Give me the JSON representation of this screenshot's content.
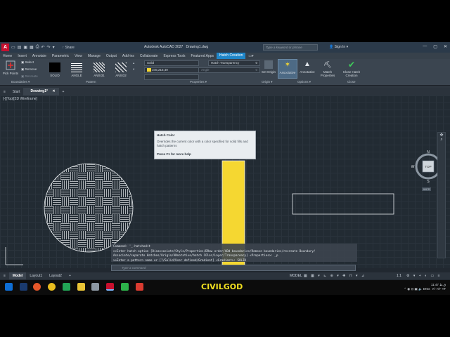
{
  "titlebar": {
    "app_title": "Autodesk AutoCAD 2027",
    "file_title": "Drawing1.dwg",
    "share_label": "Share",
    "search_placeholder": "Type a keyword or phrase",
    "signin_label": "Sign In"
  },
  "ribbon_tabs": [
    "Home",
    "Insert",
    "Annotate",
    "Parametric",
    "View",
    "Manage",
    "Output",
    "Add-ins",
    "Collaborate",
    "Express Tools",
    "Featured Apps",
    "Hatch Creation"
  ],
  "ribbon": {
    "pick_points": "Pick Points",
    "select": "Select",
    "remove": "Remove",
    "recreate": "Recreate",
    "boundaries_label": "Boundaries",
    "patterns": [
      "SOLID",
      "ANGLE",
      "ANSI31",
      "ANSI32"
    ],
    "pattern_label": "Pattern",
    "prop_type": "Solid",
    "prop_color": "245,215,49",
    "prop_transparency_label": "Hatch Transparency",
    "prop_transparency_value": "0",
    "prop_angle_label": "Angle",
    "prop_angle_value": "0",
    "properties_label": "Properties",
    "set_origin": "Set Origin",
    "origin_label": "Origin",
    "associative": "Associative",
    "annotative": "Annotative",
    "match_properties": "Match Properties",
    "options_label": "Options",
    "close_hatch": "Close Hatch Creation",
    "close_label": "Close"
  },
  "file_tabs": [
    "Start",
    "Drawing1*"
  ],
  "viewport_label": "[-][Top][2D Wireframe]",
  "tooltip": {
    "title": "Hatch Color",
    "description": "Overrides the current color with a color specified for solid fills and hatch patterns",
    "help": "Press F1 for more help"
  },
  "command_history": [
    "Command: '_-hatchedit",
    ">>Enter hatch option [Disassociate/Style/Properties/DRaw order/ADd boundaries/Remove boundaries/recreate Boundary/",
    "Associate/separate Hatches/Origin/ANnotative/hatch COlor/Layer/Transparency] <Properties>: _p",
    ">>Enter a pattern name or [?/Solid/User defined/Gradient] <Gradient>: SOLID"
  ],
  "command_placeholder": "Type a command",
  "layout_tabs": [
    "Model",
    "Layout1",
    "Layout2"
  ],
  "status": {
    "model_label": "MODEL",
    "scale": "1:1",
    "time": "11:47 ق.ظ",
    "date": "۷/۰۶/۲۰۲۴",
    "lang": "ENG"
  },
  "watermark": "CIVILGOD",
  "viewcube": {
    "top": "TOP",
    "n": "N",
    "s": "S",
    "e": "E",
    "w": "W",
    "wcs": "WCS"
  },
  "colors": {
    "accent": "#1f86c9",
    "hatch_fill": "#f5d731",
    "watermark": "#f2e020"
  }
}
